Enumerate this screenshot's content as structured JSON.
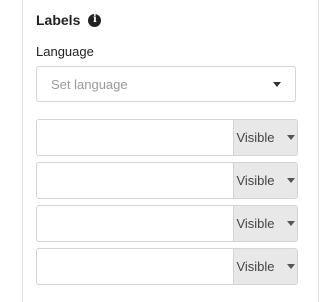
{
  "section": {
    "title": "Labels",
    "info_icon": "info-icon"
  },
  "language": {
    "label": "Language",
    "placeholder": "Set language"
  },
  "label_rows": [
    {
      "value": "",
      "visibility": "Visible"
    },
    {
      "value": "",
      "visibility": "Visible"
    },
    {
      "value": "",
      "visibility": "Visible"
    },
    {
      "value": "",
      "visibility": "Visible"
    }
  ]
}
